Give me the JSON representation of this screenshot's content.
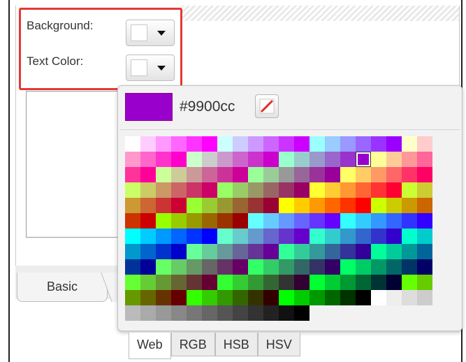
{
  "form": {
    "background_label": "Background:",
    "text_color_label": "Text Color:"
  },
  "tabs": {
    "basic_label": "Basic"
  },
  "picker": {
    "current_color": "#9900cc",
    "hex_text": "#9900cc",
    "mode_tabs": [
      "Web",
      "RGB",
      "HSB",
      "HSV"
    ],
    "active_mode": "Web",
    "palette_rows": [
      [
        "#ffffff",
        "#ffccff",
        "#ff99ff",
        "#ff66ff",
        "#ff33ff",
        "#ff00ff",
        "#ccffff",
        "#ccccff",
        "#cc99ff",
        "#cc66ff",
        "#cc33ff",
        "#cc00ff",
        "#99ffff",
        "#99ccff",
        "#9999ff",
        "#9966ff",
        "#9933ff",
        "#9900ff",
        "#ffffcc",
        "#ffcccc"
      ],
      [
        "#ff99cc",
        "#ff66cc",
        "#ff33cc",
        "#ff00cc",
        "#ccffcc",
        "#cccccc",
        "#cc99cc",
        "#cc66cc",
        "#cc33cc",
        "#cc00cc",
        "#99ffcc",
        "#99cccc",
        "#9999cc",
        "#9966cc",
        "#9933cc",
        "#9900cc",
        "#ffff99",
        "#ffcc99",
        "#ff9999",
        "#ff6699"
      ],
      [
        "#ff3399",
        "#ff0099",
        "#ccff99",
        "#cccc99",
        "#cc9999",
        "#cc6699",
        "#cc3399",
        "#cc0099",
        "#99ff99",
        "#99cc99",
        "#999999",
        "#996699",
        "#993399",
        "#990099",
        "#ffff66",
        "#ffcc66",
        "#ff9966",
        "#ff6666",
        "#ff3366",
        "#ff0066"
      ],
      [
        "#ccff66",
        "#cccc66",
        "#cc9966",
        "#cc6666",
        "#cc3366",
        "#cc0066",
        "#99ff66",
        "#99cc66",
        "#999966",
        "#996666",
        "#993366",
        "#990066",
        "#ffff33",
        "#ffcc33",
        "#ff9933",
        "#ff6633",
        "#ff3333",
        "#ff0033",
        "#ccff33",
        "#cccc33"
      ],
      [
        "#cc9933",
        "#cc6633",
        "#cc3333",
        "#cc0033",
        "#99ff33",
        "#99cc33",
        "#999933",
        "#996633",
        "#993333",
        "#990033",
        "#ffff00",
        "#ffcc00",
        "#ff9900",
        "#ff6600",
        "#ff3300",
        "#ff0000",
        "#ccff00",
        "#cccc00",
        "#cc9900",
        "#cc6600"
      ],
      [
        "#cc3300",
        "#cc0000",
        "#99ff00",
        "#99cc00",
        "#999900",
        "#996600",
        "#993300",
        "#990000",
        "#66ffff",
        "#66ccff",
        "#6699ff",
        "#6666ff",
        "#6633ff",
        "#6600ff",
        "#33ffff",
        "#33ccff",
        "#3399ff",
        "#3366ff",
        "#3333ff",
        "#3300ff"
      ],
      [
        "#00ffff",
        "#00ccff",
        "#0099ff",
        "#0066ff",
        "#0033ff",
        "#0000ff",
        "#66ffcc",
        "#66cccc",
        "#6699cc",
        "#6666cc",
        "#6633cc",
        "#6600cc",
        "#33ffcc",
        "#33cccc",
        "#3399cc",
        "#3366cc",
        "#3333cc",
        "#3300cc",
        "#00ffcc",
        "#00cccc"
      ],
      [
        "#0099cc",
        "#0066cc",
        "#0033cc",
        "#0000cc",
        "#66ff99",
        "#66cc99",
        "#669999",
        "#666699",
        "#663399",
        "#660099",
        "#33ff99",
        "#33cc99",
        "#339999",
        "#336699",
        "#333399",
        "#330099",
        "#00ff99",
        "#00cc99",
        "#009999",
        "#006699"
      ],
      [
        "#003399",
        "#000099",
        "#66ff66",
        "#66cc66",
        "#669966",
        "#666666",
        "#663366",
        "#660066",
        "#33ff66",
        "#33cc66",
        "#339966",
        "#336666",
        "#333366",
        "#330066",
        "#00ff66",
        "#00cc66",
        "#009966",
        "#006666",
        "#003366",
        "#000066"
      ],
      [
        "#66ff33",
        "#66cc33",
        "#669933",
        "#666633",
        "#663333",
        "#660033",
        "#33ff33",
        "#33cc33",
        "#339933",
        "#336633",
        "#333333",
        "#330033",
        "#00ff33",
        "#00cc33",
        "#009933",
        "#006633",
        "#003333",
        "#000033",
        "#66ff00",
        "#66cc00"
      ],
      [
        "#669900",
        "#666600",
        "#663300",
        "#660000",
        "#33ff00",
        "#33cc00",
        "#339900",
        "#336600",
        "#333300",
        "#330000",
        "#00ff00",
        "#00cc00",
        "#009900",
        "#006600",
        "#003300",
        "#000000",
        "#ffffff",
        "#eeeeee",
        "#dddddd",
        "#cccccc"
      ],
      [
        "#bbbbbb",
        "#aaaaaa",
        "#999999",
        "#888888",
        "#777777",
        "#666666",
        "#555555",
        "#444444",
        "#333333",
        "#222222",
        "#111111",
        "#000000"
      ]
    ],
    "selected_color": "#9900cc"
  }
}
